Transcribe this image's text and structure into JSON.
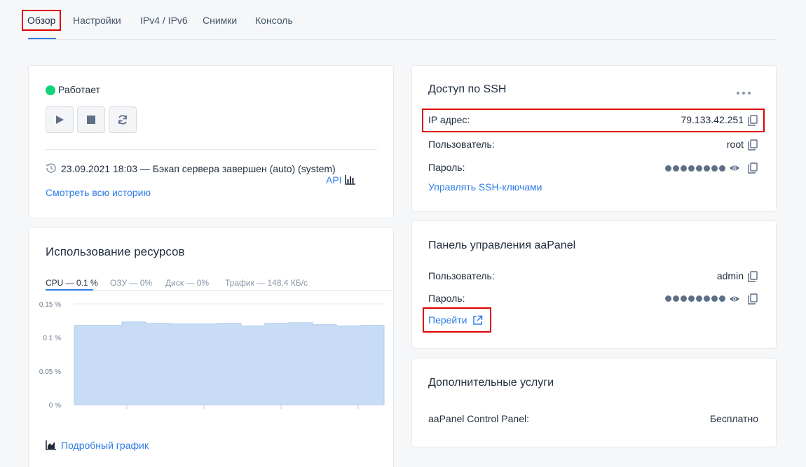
{
  "tabs": [
    {
      "label": "Обзор"
    },
    {
      "label": "Настройки"
    },
    {
      "label": "IPv4 / IPv6"
    },
    {
      "label": "Снимки"
    },
    {
      "label": "Консоль"
    }
  ],
  "status": {
    "label": "Работает",
    "color": "#12d27a",
    "history_entry": "23.09.2021 18:03 — Бэкап сервера завершен (auto) (system)",
    "history_link": "Смотреть всю историю"
  },
  "resources": {
    "title": "Использование ресурсов",
    "api_label": "API",
    "tabs": [
      {
        "label": "CPU — 0.1 %"
      },
      {
        "label": "ОЗУ — 0%"
      },
      {
        "label": "Диск — 0%"
      },
      {
        "label": "Трафик — 148,4 КБ/с"
      }
    ],
    "details_link": "Подробный график"
  },
  "chart_data": {
    "type": "area",
    "y_ticks": [
      "0.15 %",
      "0.1 %",
      "0.05 %",
      "0 %"
    ],
    "ylim": [
      0,
      0.15
    ],
    "values": [
      0.118,
      0.118,
      0.123,
      0.121,
      0.12,
      0.12,
      0.121,
      0.117,
      0.121,
      0.122,
      0.119,
      0.117,
      0.118
    ],
    "fill_color": "#c8ddf5",
    "line_color": "#a9c9ef",
    "grid": true
  },
  "ssh": {
    "title": "Доступ по SSH",
    "ip_label": "IP адрес:",
    "ip_value": "79.133.42.251",
    "user_label": "Пользователь:",
    "user_value": "root",
    "password_label": "Пароль:",
    "keys_link": "Управлять SSH-ключами"
  },
  "aapanel": {
    "title": "Панель управления aaPanel",
    "user_label": "Пользователь:",
    "user_value": "admin",
    "password_label": "Пароль:",
    "go_link": "Перейти"
  },
  "extra": {
    "title": "Дополнительные услуги",
    "service_name": "aaPanel Control Panel:",
    "service_price": "Бесплатно"
  },
  "colors": {
    "accent": "#2e7be6",
    "highlight": "#e00000"
  }
}
